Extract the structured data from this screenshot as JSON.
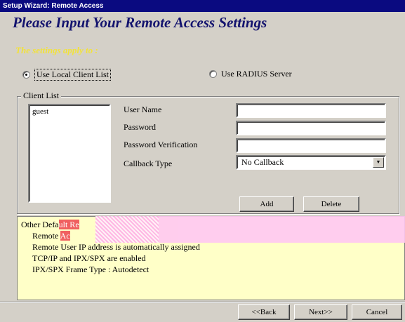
{
  "window": {
    "title": "Setup Wizard: Remote Access"
  },
  "page": {
    "heading": "Please Input Your Remote Access Settings",
    "subheading": "The settings apply to :"
  },
  "source_options": [
    {
      "label": "Use Local Client List",
      "selected": true
    },
    {
      "label": "Use RADIUS Server",
      "selected": false
    }
  ],
  "client_list": {
    "legend": "Client List",
    "items": [
      "guest"
    ]
  },
  "form": {
    "user_name_label": "User Name",
    "user_name_value": "",
    "password_label": "Password",
    "password_value": "",
    "password_verification_label": "Password Verification",
    "password_verification_value": "",
    "callback_type_label": "Callback Type",
    "callback_type_value": "No Callback",
    "add_label": "Add",
    "delete_label": "Delete"
  },
  "info": {
    "line1_prefix": "Other Defa",
    "line1_highlight": "ult Re",
    "line2_prefix": "Remote ",
    "line2_highlight": "Ac",
    "line3": "Remote User IP address is automatically assigned",
    "line4": "TCP/IP and IPX/SPX are enabled",
    "line5": "IPX/SPX Frame Type : Autodetect"
  },
  "nav": {
    "back_label": "<<Back",
    "next_label": "Next>>",
    "cancel_label": "Cancel"
  },
  "colors": {
    "titlebar": "#0a0a80",
    "heading": "#13136e",
    "subheading": "#f2e23a",
    "info_background": "#ffffc8",
    "highlight": "#f06060"
  }
}
